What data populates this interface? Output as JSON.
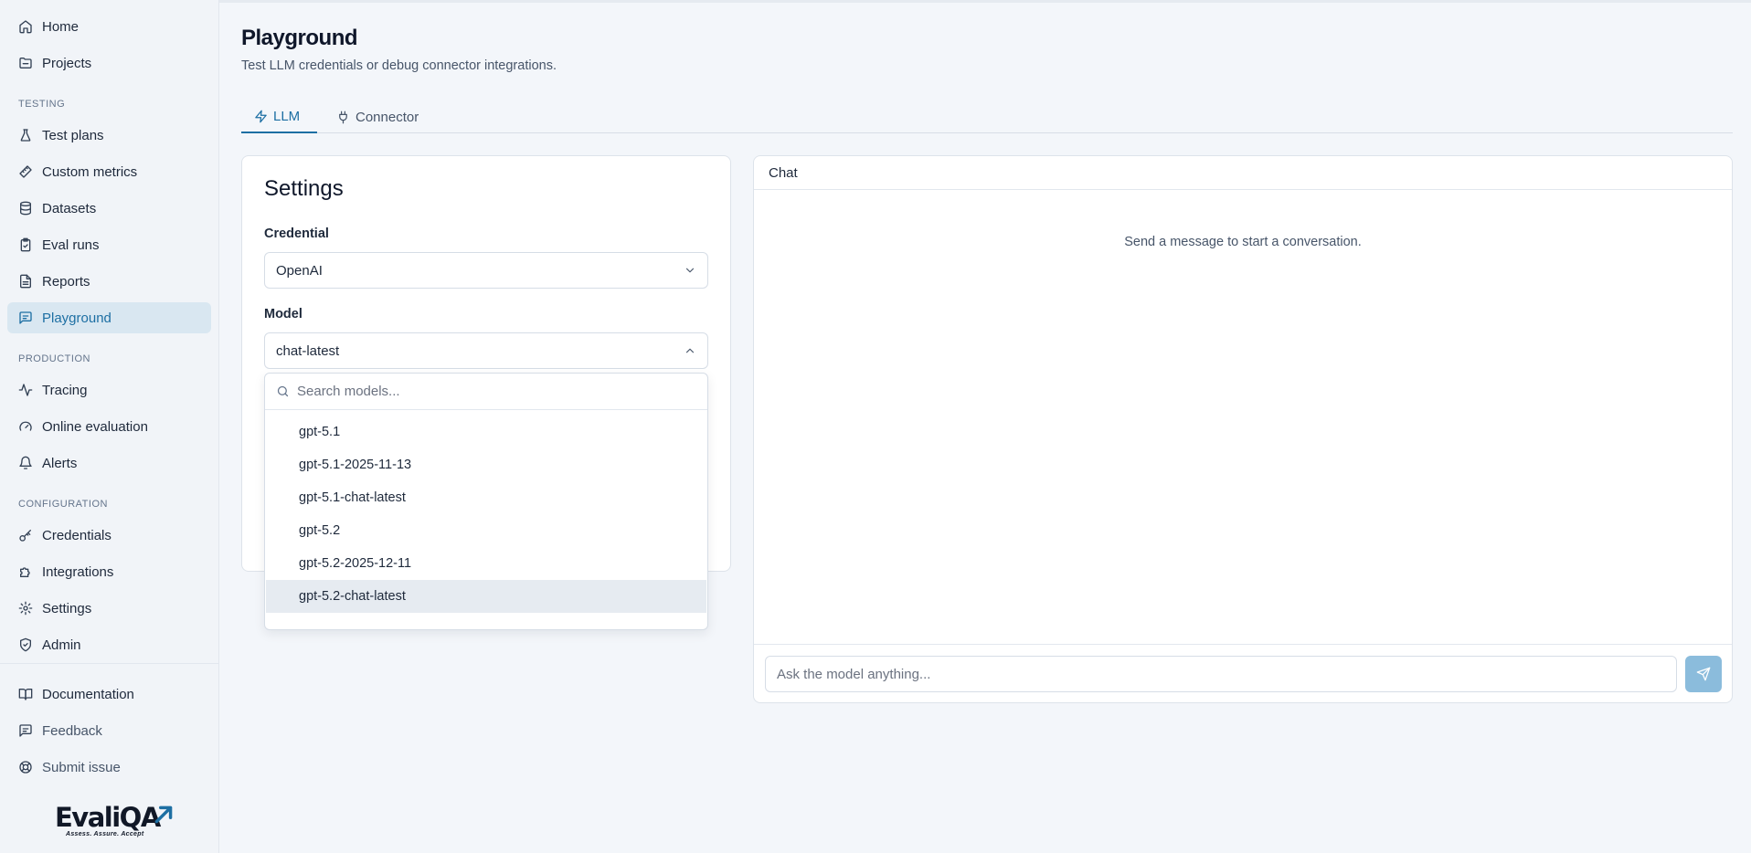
{
  "sidebar": {
    "items": [
      {
        "label": "Home",
        "icon": "home-icon"
      },
      {
        "label": "Projects",
        "icon": "folder-icon"
      },
      {
        "label": "Test plans",
        "icon": "flask-icon"
      },
      {
        "label": "Custom metrics",
        "icon": "ruler-icon"
      },
      {
        "label": "Datasets",
        "icon": "database-icon"
      },
      {
        "label": "Eval runs",
        "icon": "clipboard-check-icon"
      },
      {
        "label": "Reports",
        "icon": "file-text-icon"
      },
      {
        "label": "Playground",
        "icon": "message-square-icon"
      },
      {
        "label": "Tracing",
        "icon": "activity-icon"
      },
      {
        "label": "Online evaluation",
        "icon": "gauge-icon"
      },
      {
        "label": "Alerts",
        "icon": "bell-icon"
      },
      {
        "label": "Credentials",
        "icon": "key-icon"
      },
      {
        "label": "Integrations",
        "icon": "puzzle-icon"
      },
      {
        "label": "Settings",
        "icon": "gear-icon"
      },
      {
        "label": "Admin",
        "icon": "shield-check-icon"
      },
      {
        "label": "Documentation",
        "icon": "book-icon"
      },
      {
        "label": "Feedback",
        "icon": "message-square-icon"
      },
      {
        "label": "Submit issue",
        "icon": "lifebuoy-icon"
      }
    ],
    "sections": {
      "testing": "TESTING",
      "production": "PRODUCTION",
      "configuration": "CONFIGURATION"
    },
    "active": "Playground",
    "logo": {
      "word": "EvaliQA",
      "tagline": "Assess. Assure. Accept"
    }
  },
  "page": {
    "title": "Playground",
    "subtitle": "Test LLM credentials or debug connector integrations."
  },
  "tabs": [
    {
      "label": "LLM",
      "icon": "zap-icon",
      "active": true
    },
    {
      "label": "Connector",
      "icon": "plug-icon",
      "active": false
    }
  ],
  "settings": {
    "title": "Settings",
    "credential_label": "Credential",
    "credential_value": "OpenAI",
    "model_label": "Model",
    "model_value": "chat-latest"
  },
  "model_dropdown": {
    "search_placeholder": "Search models...",
    "options": [
      "gpt-5.1",
      "gpt-5.1-2025-11-13",
      "gpt-5.1-chat-latest",
      "gpt-5.2",
      "gpt-5.2-2025-12-11",
      "gpt-5.2-chat-latest"
    ],
    "highlighted": "gpt-5.2-chat-latest"
  },
  "chat": {
    "title": "Chat",
    "empty_message": "Send a message to start a conversation.",
    "input_placeholder": "Ask the model anything...",
    "send_icon": "send-icon"
  },
  "colors": {
    "accent": "#1d6fa3",
    "active_bg": "#d9e7f1",
    "send_button": "#8bbcdc",
    "highlight": "#e6ebf1"
  }
}
